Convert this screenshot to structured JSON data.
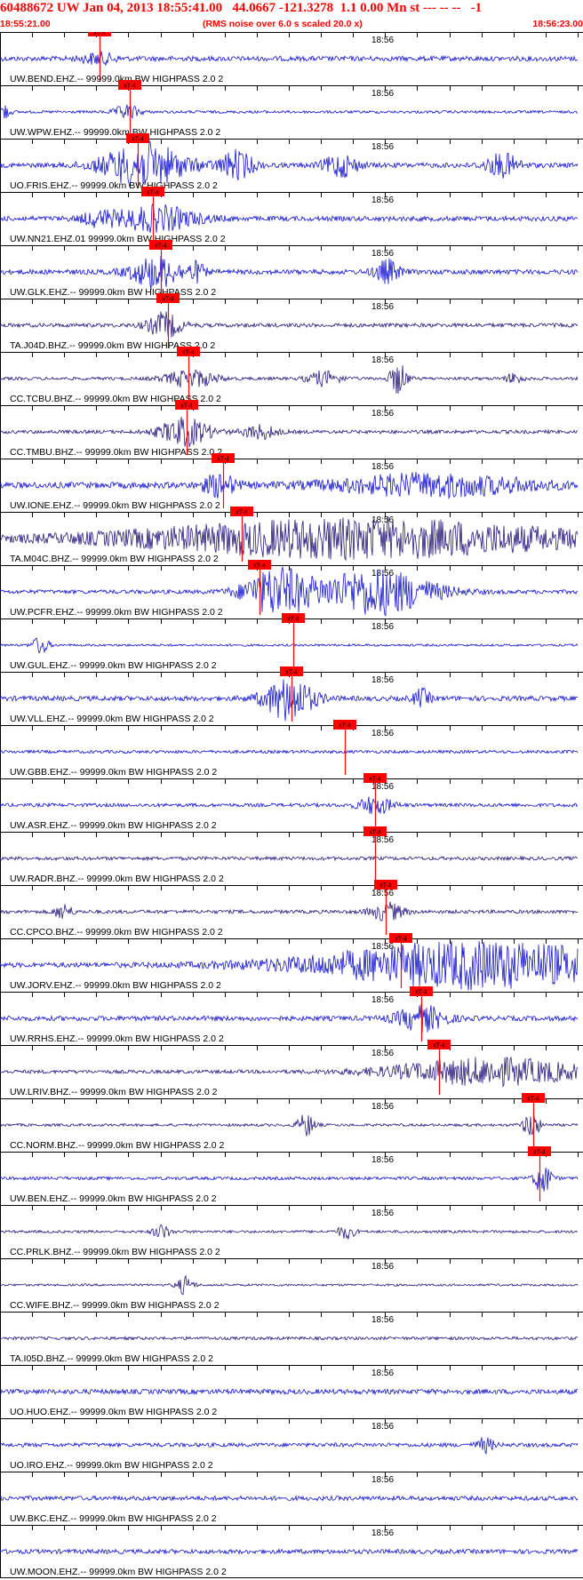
{
  "header": {
    "title": "60488672 UW Jan 04, 2013 18:55:41.00   44.0667 -121.3278  1.1 0.00 Mn st --- -- --   -1",
    "start_time": "18:55:21.00",
    "subtitle": "(RMS noise over 6.0 s scaled 20.0 x)",
    "end_time": "18:56:23.00"
  },
  "chart_data": {
    "type": "line",
    "time_start": "18:55:21.00",
    "time_end": "18:56:23.00",
    "center_tick_label": "18:56",
    "pick_label": "xT-4",
    "trace_filter": "99999.0km BW  HIGHPASS  2.0  2",
    "traces": [
      {
        "station": "UW.BEND.EHZ.--",
        "color": "#1515d0",
        "pick_x": 0.17,
        "amp": 0.55,
        "bursts": [
          [
            0.17,
            0.6,
            0.02
          ]
        ]
      },
      {
        "station": "UW.WPW.EHZ.--",
        "color": "#1515d0",
        "pick_x": 0.222,
        "amp": 0.3,
        "bursts": [
          [
            0.0,
            1.2,
            0.01
          ],
          [
            0.22,
            0.8,
            0.015
          ]
        ]
      },
      {
        "station": "UO.FRIS.EHZ.--",
        "color": "#1515d0",
        "pick_x": 0.237,
        "amp": 0.55,
        "bursts": [
          [
            0.25,
            2.5,
            0.05
          ],
          [
            0.41,
            1.6,
            0.02
          ],
          [
            0.59,
            1.3,
            0.02
          ],
          [
            0.87,
            1.3,
            0.02
          ]
        ]
      },
      {
        "station": "UW.NN21.EHZ.01",
        "color": "#1515d0",
        "pick_x": 0.262,
        "amp": 0.55,
        "bursts": [
          [
            0.17,
            0.7,
            0.02
          ],
          [
            0.27,
            1.4,
            0.05
          ]
        ]
      },
      {
        "station": "UW.GLK.EHZ.--",
        "color": "#1515d0",
        "pick_x": 0.276,
        "amp": 0.55,
        "bursts": [
          [
            0.27,
            1.8,
            0.03
          ],
          [
            0.34,
            1.0,
            0.01
          ],
          [
            0.67,
            1.3,
            0.015
          ]
        ]
      },
      {
        "station": "TA.J04D.BHZ.--",
        "color": "#2a1a80",
        "pick_x": 0.288,
        "amp": 0.45,
        "bursts": [
          [
            0.285,
            1.4,
            0.02
          ]
        ]
      },
      {
        "station": "CC.TCBU.BHZ.--",
        "color": "#2a1a80",
        "pick_x": 0.323,
        "amp": 0.35,
        "bursts": [
          [
            0.33,
            1.0,
            0.03
          ],
          [
            0.56,
            0.8,
            0.02
          ],
          [
            0.69,
            1.8,
            0.01
          ],
          [
            0.89,
            0.6,
            0.01
          ]
        ]
      },
      {
        "station": "CC.TMBU.BHZ.--",
        "color": "#2a1a80",
        "pick_x": 0.32,
        "amp": 0.4,
        "bursts": [
          [
            0.32,
            1.6,
            0.03
          ],
          [
            0.45,
            0.8,
            0.02
          ]
        ]
      },
      {
        "station": "UW.IONE.EHZ.--",
        "color": "#1515d0",
        "pick_x": 0.382,
        "amp": 0.7,
        "bursts": [
          [
            0.38,
            1.2,
            0.02
          ],
          [
            0.75,
            1.2,
            0.12
          ]
        ]
      },
      {
        "station": "TA.M04C.BHZ.--",
        "color": "#2a1a80",
        "pick_x": 0.415,
        "amp": 0.55,
        "bursts": [
          [
            0.62,
            2.2,
            0.28
          ]
        ]
      },
      {
        "station": "UW.PCFR.EHZ.--",
        "color": "#1515d0",
        "pick_x": 0.445,
        "amp": 0.45,
        "bursts": [
          [
            0.48,
            2.6,
            0.04
          ],
          [
            0.65,
            2.6,
            0.07
          ]
        ]
      },
      {
        "station": "UW.GUL.EHZ.--",
        "color": "#1515d0",
        "pick_x": 0.503,
        "amp": 0.25,
        "bursts": [
          [
            0.07,
            1.0,
            0.01
          ]
        ]
      },
      {
        "station": "UW.VLL.EHZ.--",
        "color": "#1515d0",
        "pick_x": 0.5,
        "amp": 0.55,
        "bursts": [
          [
            0.5,
            2.4,
            0.03
          ],
          [
            0.73,
            1.0,
            0.01
          ]
        ]
      },
      {
        "station": "UW.GBB.EHZ.--",
        "color": "#1515d0",
        "pick_x": 0.592,
        "amp": 0.35,
        "bursts": []
      },
      {
        "station": "UW.ASR.EHZ.--",
        "color": "#1515d0",
        "pick_x": 0.643,
        "amp": 0.4,
        "bursts": [
          [
            0.65,
            1.0,
            0.02
          ]
        ]
      },
      {
        "station": "UW.RADR.BHZ.--",
        "color": "#2a1a80",
        "pick_x": 0.643,
        "amp": 0.4,
        "bursts": []
      },
      {
        "station": "CC.CPCO.BHZ.--",
        "color": "#2a1a80",
        "pick_x": 0.661,
        "amp": 0.4,
        "bursts": [
          [
            0.11,
            0.9,
            0.01
          ],
          [
            0.67,
            1.0,
            0.02
          ]
        ]
      },
      {
        "station": "UW.JORV.EHZ.--",
        "color": "#1515d0",
        "pick_x": 0.687,
        "amp": 0.55,
        "bursts": [
          [
            0.83,
            2.6,
            0.2
          ]
        ]
      },
      {
        "station": "UW.RRHS.EHZ.--",
        "color": "#1515d0",
        "pick_x": 0.722,
        "amp": 0.55,
        "bursts": [
          [
            0.73,
            1.4,
            0.03
          ]
        ]
      },
      {
        "station": "UW.LRIV.BHZ.--",
        "color": "#2a1a80",
        "pick_x": 0.753,
        "amp": 0.4,
        "bursts": [
          [
            0.85,
            1.5,
            0.12
          ]
        ]
      },
      {
        "station": "CC.NORM.BHZ.--",
        "color": "#2a1a80",
        "pick_x": 0.914,
        "amp": 0.3,
        "bursts": [
          [
            0.53,
            1.3,
            0.01
          ],
          [
            0.92,
            1.4,
            0.01
          ]
        ]
      },
      {
        "station": "UW.BEN.EHZ.--",
        "color": "#1515d0",
        "pick_x": 0.925,
        "amp": 0.35,
        "bursts": [
          [
            0.94,
            1.8,
            0.01
          ]
        ]
      },
      {
        "station": "CC.PRLK.BHZ.--",
        "color": "#2a1a80",
        "pick_x": null,
        "amp": 0.3,
        "bursts": [
          [
            0.28,
            0.8,
            0.01
          ],
          [
            0.6,
            0.8,
            0.01
          ]
        ]
      },
      {
        "station": "CC.WIFE.BHZ.--",
        "color": "#2a1a80",
        "pick_x": null,
        "amp": 0.25,
        "bursts": [
          [
            0.32,
            1.0,
            0.01
          ]
        ]
      },
      {
        "station": "TA.I05D.BHZ.--",
        "color": "#2a1a80",
        "pick_x": null,
        "amp": 0.35,
        "bursts": []
      },
      {
        "station": "UO.HUO.EHZ.--",
        "color": "#1515d0",
        "pick_x": null,
        "amp": 0.55,
        "bursts": []
      },
      {
        "station": "UO.IRO.EHZ.--",
        "color": "#1515d0",
        "pick_x": null,
        "amp": 0.45,
        "bursts": [
          [
            0.84,
            0.8,
            0.01
          ]
        ]
      },
      {
        "station": "UW.BKC.EHZ.--",
        "color": "#1515d0",
        "pick_x": null,
        "amp": 0.5,
        "bursts": []
      },
      {
        "station": "UW.MOON.EHZ.--",
        "color": "#1515d0",
        "pick_x": null,
        "amp": 0.5,
        "bursts": []
      }
    ]
  }
}
